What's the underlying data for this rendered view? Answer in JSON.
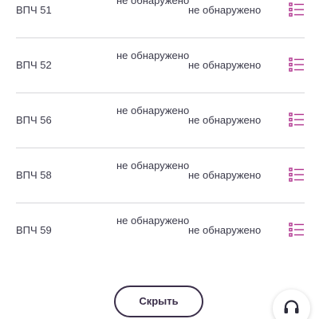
{
  "results": {
    "rows": [
      {
        "name": "ВПЧ 51",
        "result_1": "не обнаружено",
        "result_2": "не обнаружено"
      },
      {
        "name": "ВПЧ 52",
        "result_1": "не обнаружено",
        "result_2": "не обнаружено"
      },
      {
        "name": "ВПЧ 56",
        "result_1": "не обнаружено",
        "result_2": "не обнаружено"
      },
      {
        "name": "ВПЧ 58",
        "result_1": "не обнаружено",
        "result_2": "не обнаружено"
      },
      {
        "name": "ВПЧ 59",
        "result_1": "не обнаружено",
        "result_2": "не обнаружено"
      }
    ]
  },
  "hide_button": {
    "label": "Скрыть"
  },
  "icons": {
    "row_action": "list-icon",
    "support": "headphones-icon"
  },
  "colors": {
    "accent_magenta": "#b0338e",
    "button_border": "#3b2f4a",
    "divider": "#d6d6da",
    "text": "#3a3a4a"
  }
}
